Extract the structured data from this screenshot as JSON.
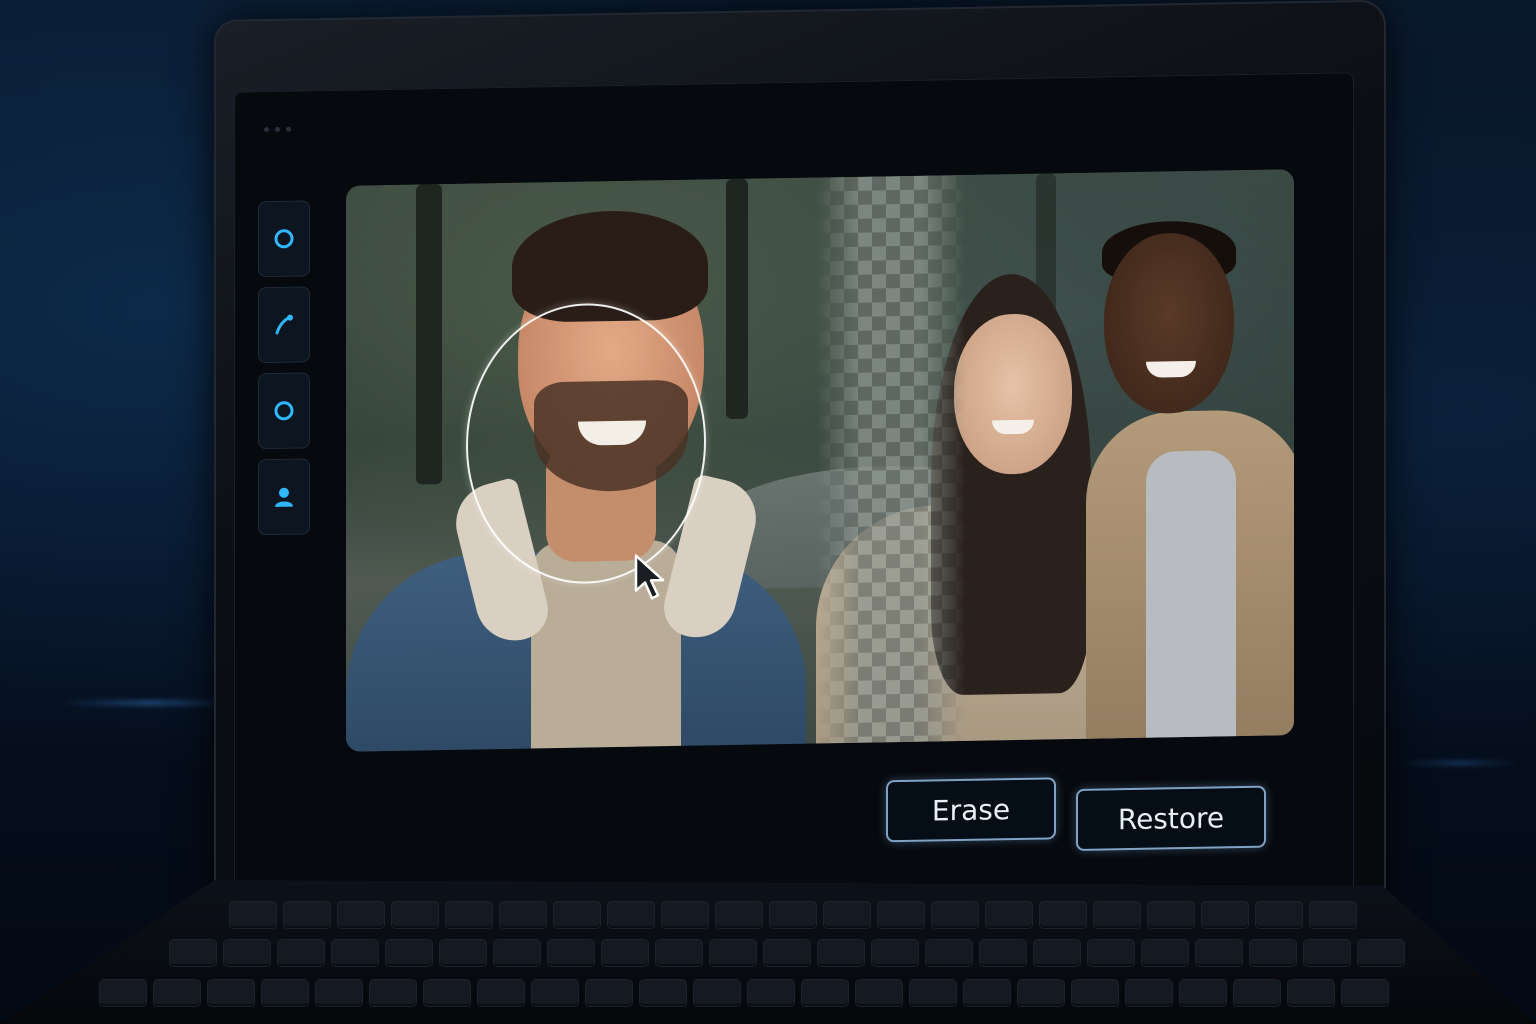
{
  "app": {
    "actions": {
      "erase_label": "Erase",
      "restore_label": "Restore"
    },
    "toolbar": {
      "tools": [
        {
          "id": "circle-tool",
          "icon": "circle-icon",
          "active": false
        },
        {
          "id": "brush-tool",
          "icon": "brush-icon",
          "active": false
        },
        {
          "id": "circle-tool-2",
          "icon": "circle-icon",
          "active": false
        },
        {
          "id": "person-tool",
          "icon": "person-icon",
          "active": true
        }
      ]
    },
    "canvas": {
      "content": "photo",
      "brush_shape": "circle",
      "transparency": "checkerboard"
    }
  },
  "colors": {
    "accent": "#2fb8ff",
    "button_border": "#7fa3c4",
    "button_text": "#e8f0f8",
    "background": "#050b16"
  }
}
